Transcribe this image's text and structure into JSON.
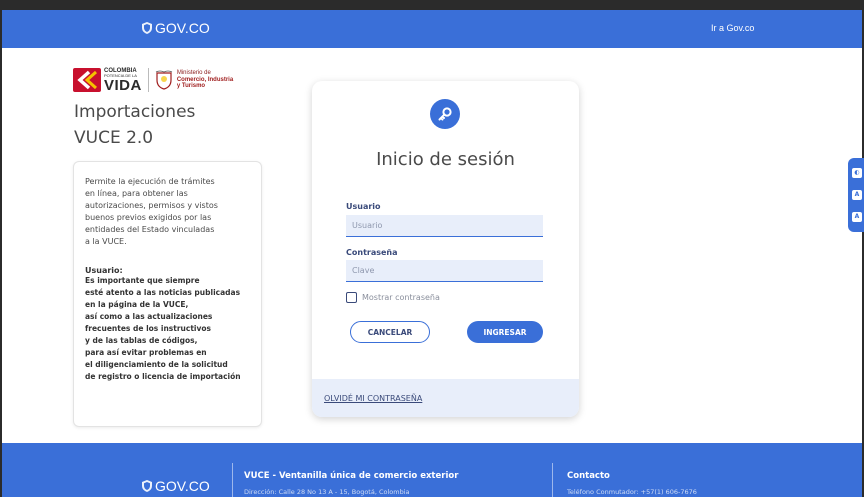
{
  "topbar": {
    "logo_text": "GOV.CO",
    "link_label": "Ir a Gov.co"
  },
  "brand": {
    "colombia_small": "COLOMBIA",
    "colombia_tiny": "POTENCIA DE LA",
    "colombia_big": "VIDA",
    "ministry_line1": "Ministerio de",
    "ministry_line2": "Comercio, Industria",
    "ministry_line3": "y Turismo"
  },
  "app": {
    "title": "Importaciones",
    "subtitle": "VUCE 2.0"
  },
  "info": {
    "description": "Permite la ejecución de trámites\nen línea, para obtener las\nautorizaciones, permisos y vistos\nbuenos previos exigidos por las\nentidades del Estado vinculadas\na la VUCE.",
    "note_title": "Usuario:",
    "note": "Es importante que siempre\nesté atento a las noticias publicadas\nen la página de la VUCE,\nasí como a las actualizaciones\nfrecuentes de los instructivos\ny de las tablas de códigos,\npara así evitar problemas en\nel diligenciamiento de la solicitud\nde registro o licencia de importación"
  },
  "login": {
    "title": "Inicio de sesión",
    "user_label": "Usuario",
    "user_placeholder": "Usuario",
    "user_value": "",
    "pass_label": "Contraseña",
    "pass_placeholder": "Clave",
    "pass_value": "",
    "show_password_label": "Mostrar contraseña",
    "show_password_checked": false,
    "cancel_label": "CANCELAR",
    "submit_label": "INGRESAR",
    "forgot_label": "OLVIDÉ MI CONTRASEÑA"
  },
  "footer": {
    "logo_text": "GOV.CO",
    "vuce_title": "VUCE - Ventanilla única de comercio exterior",
    "vuce_address": "Dirección: Calle 28 No 13 A - 15, Bogotá, Colombia",
    "contact_title": "Contacto",
    "contact_phone": "Teléfono Conmutador: +57(1) 606-7676"
  },
  "colors": {
    "primary": "#3a6fd8",
    "input_bg": "#e8eefa",
    "text": "#4a4a4a"
  }
}
